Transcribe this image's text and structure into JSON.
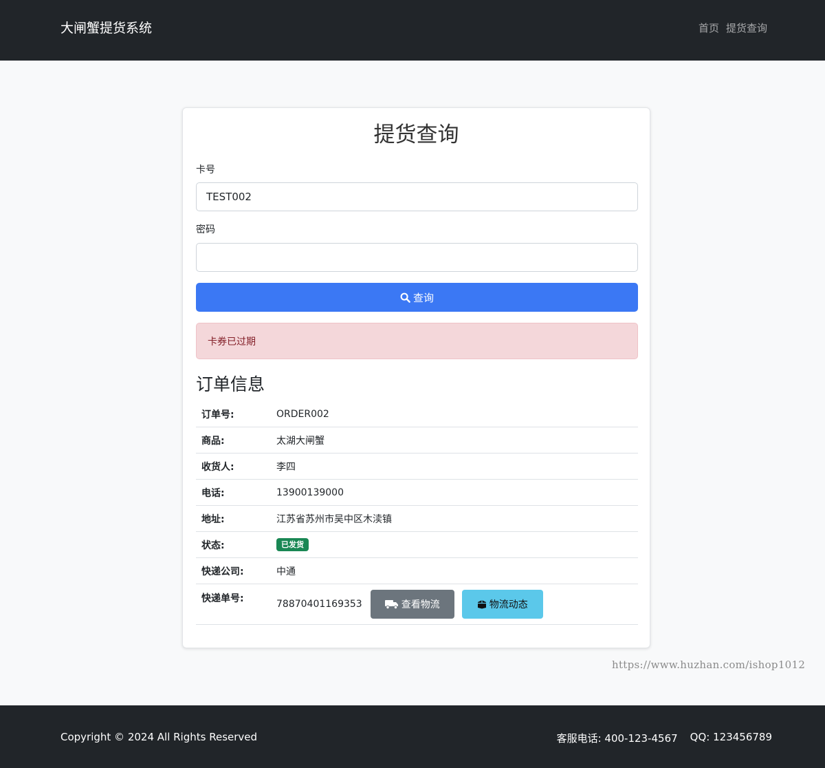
{
  "navbar": {
    "brand": "大闸蟹提货系统",
    "links": [
      "首页",
      "提货查询"
    ]
  },
  "form": {
    "title": "提货查询",
    "card_label": "卡号",
    "card_value": "TEST002",
    "password_label": "密码",
    "password_value": "",
    "query_button": "查询",
    "alert": "卡券已过期"
  },
  "order": {
    "title": "订单信息",
    "rows": [
      {
        "label": "订单号:",
        "value": "ORDER002"
      },
      {
        "label": "商品:",
        "value": "太湖大闸蟹"
      },
      {
        "label": "收货人:",
        "value": "李四"
      },
      {
        "label": "电话:",
        "value": "13900139000"
      },
      {
        "label": "地址:",
        "value": "江苏省苏州市吴中区木渎镇"
      },
      {
        "label": "状态:",
        "value": "已发货"
      },
      {
        "label": "快递公司:",
        "value": "中通"
      },
      {
        "label": "快递单号:",
        "value": "78870401169353"
      }
    ],
    "track_button": "查看物流",
    "dynamic_button": "物流动态"
  },
  "watermark": "https://www.huzhan.com/ishop1012",
  "footer": {
    "copyright": "Copyright © 2024 All Rights Reserved",
    "phone": "客服电话: 400-123-4567",
    "qq": "QQ: 123456789"
  },
  "icons": {
    "query_button": "search-icon",
    "track_button": "truck-icon",
    "dynamic_button": "box-icon"
  },
  "colors": {
    "navbar": "#212529",
    "primary": "#3b78f4",
    "alert_bg": "#f4d7da",
    "alert_text": "#842029",
    "badge": "#198754",
    "secondary": "#6c757d",
    "info": "#5bc8ea"
  }
}
